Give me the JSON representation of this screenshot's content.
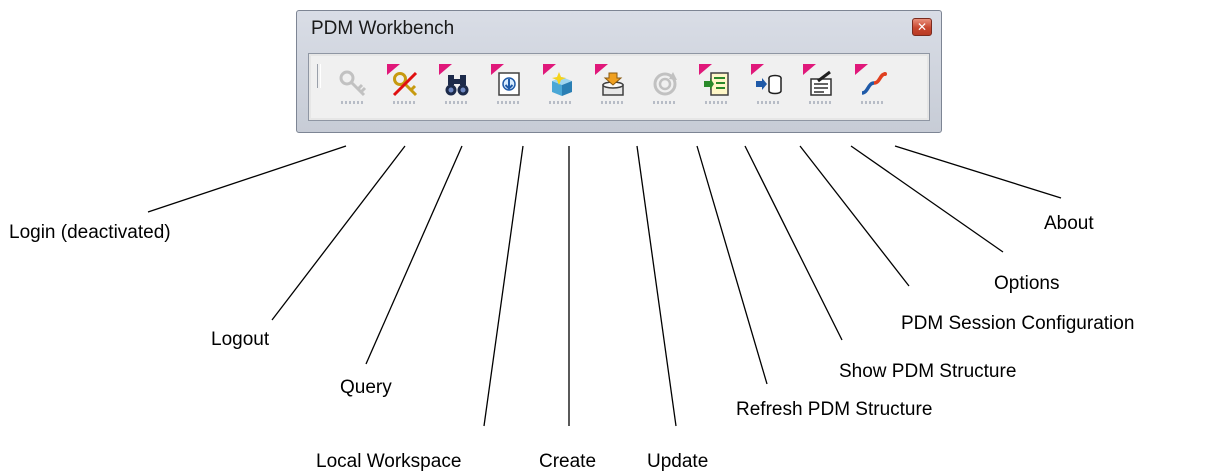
{
  "window": {
    "title": "PDM Workbench",
    "close_glyph": "✕"
  },
  "toolbar": {
    "buttons": [
      {
        "id": "login",
        "icon": "key-icon",
        "label": "Login (deactivated)",
        "enabled": false
      },
      {
        "id": "logout",
        "icon": "key-crossed-icon",
        "label": "Logout",
        "enabled": true
      },
      {
        "id": "query",
        "icon": "binoculars-icon",
        "label": "Query",
        "enabled": true
      },
      {
        "id": "local-workspace",
        "icon": "document-download-icon",
        "label": "Local Workspace",
        "enabled": true
      },
      {
        "id": "create",
        "icon": "cube-sparkle-icon",
        "label": "Create",
        "enabled": true
      },
      {
        "id": "update",
        "icon": "upload-box-icon",
        "label": "Update",
        "enabled": true
      },
      {
        "id": "refresh-pdm-structure",
        "icon": "refresh-icon",
        "label": "Refresh PDM Structure",
        "enabled": true
      },
      {
        "id": "show-pdm-structure",
        "icon": "structure-tree-icon",
        "label": "Show PDM Structure",
        "enabled": true
      },
      {
        "id": "pdm-session-configuration",
        "icon": "database-arrow-icon",
        "label": "PDM Session Configuration",
        "enabled": true
      },
      {
        "id": "options",
        "icon": "options-form-icon",
        "label": "Options",
        "enabled": true
      },
      {
        "id": "about",
        "icon": "about-swirl-icon",
        "label": "About",
        "enabled": true
      }
    ]
  },
  "colors": {
    "flag": "#e0187a",
    "title_text": "#1a1a1a",
    "close_button": "#c8472f"
  }
}
